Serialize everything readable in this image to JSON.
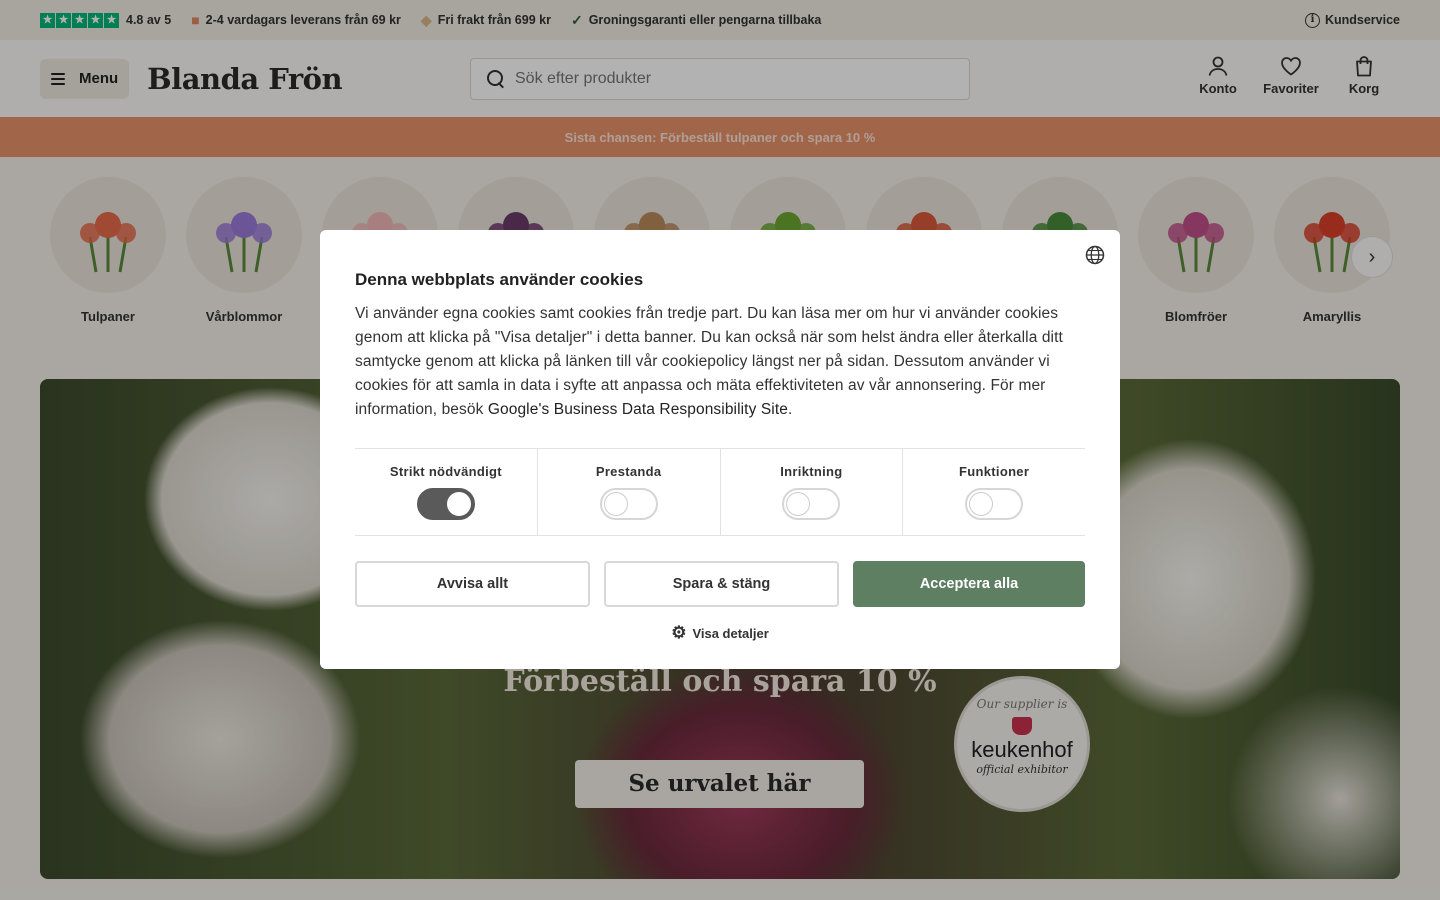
{
  "topbar": {
    "rating": "4.8 av 5",
    "delivery": "2-4 vardagars leverans från 69 kr",
    "free_shipping": "Fri frakt från 699 kr",
    "guarantee": "Groningsgaranti eller pengarna tillbaka",
    "customer_service": "Kundservice"
  },
  "header": {
    "menu_label": "Menu",
    "logo": "Blanda Frön",
    "search_placeholder": "Sök efter produkter",
    "account": "Konto",
    "favorites": "Favoriter",
    "cart": "Korg"
  },
  "promo": {
    "text": "Sista chansen: Förbeställ tulpaner och spara 10 %"
  },
  "categories": {
    "items": [
      {
        "label": "Tulpaner",
        "color": "#e56a4a"
      },
      {
        "label": "Vårblommor",
        "color": "#9a7ad8"
      },
      {
        "label": "",
        "color": "#f1b7b7"
      },
      {
        "label": "",
        "color": "#6b3a6a"
      },
      {
        "label": "",
        "color": "#b88a5a"
      },
      {
        "label": "",
        "color": "#6aa632"
      },
      {
        "label": "",
        "color": "#d85a3a"
      },
      {
        "label": "",
        "color": "#4a8a3a"
      },
      {
        "label": "Blomfröer",
        "color": "#c0508a"
      },
      {
        "label": "Amaryllis",
        "color": "#d8402a"
      }
    ]
  },
  "hero": {
    "title": "Förbeställ och spara 10 %",
    "button": "Se urvalet här",
    "badge_top": "Our supplier is",
    "badge_name": "keukenhof",
    "badge_sub": "official exhibitor"
  },
  "cookie": {
    "title": "Denna webbplats använder cookies",
    "text_before_link": "Vi använder egna cookies samt cookies från tredje part. Du kan läsa mer om hur vi använder cookies genom att klicka på \"Visa detaljer\" i detta banner. Du kan också när som helst ändra eller återkalla ditt samtycke genom att klicka på länken till vår cookiepolicy längst ner på sidan. Dessutom använder vi cookies för att samla in data i syfte att anpassa och mäta effektiviteten av vår annonsering. För mer information, besök ",
    "link_text": "Google's Business Data Responsibility Site",
    "text_after_link": ".",
    "toggles": [
      {
        "label": "Strikt nödvändigt",
        "on": true
      },
      {
        "label": "Prestanda",
        "on": false
      },
      {
        "label": "Inriktning",
        "on": false
      },
      {
        "label": "Funktioner",
        "on": false
      }
    ],
    "reject_all": "Avvisa allt",
    "save_close": "Spara & stäng",
    "accept_all": "Acceptera alla",
    "show_details": "Visa detaljer"
  }
}
